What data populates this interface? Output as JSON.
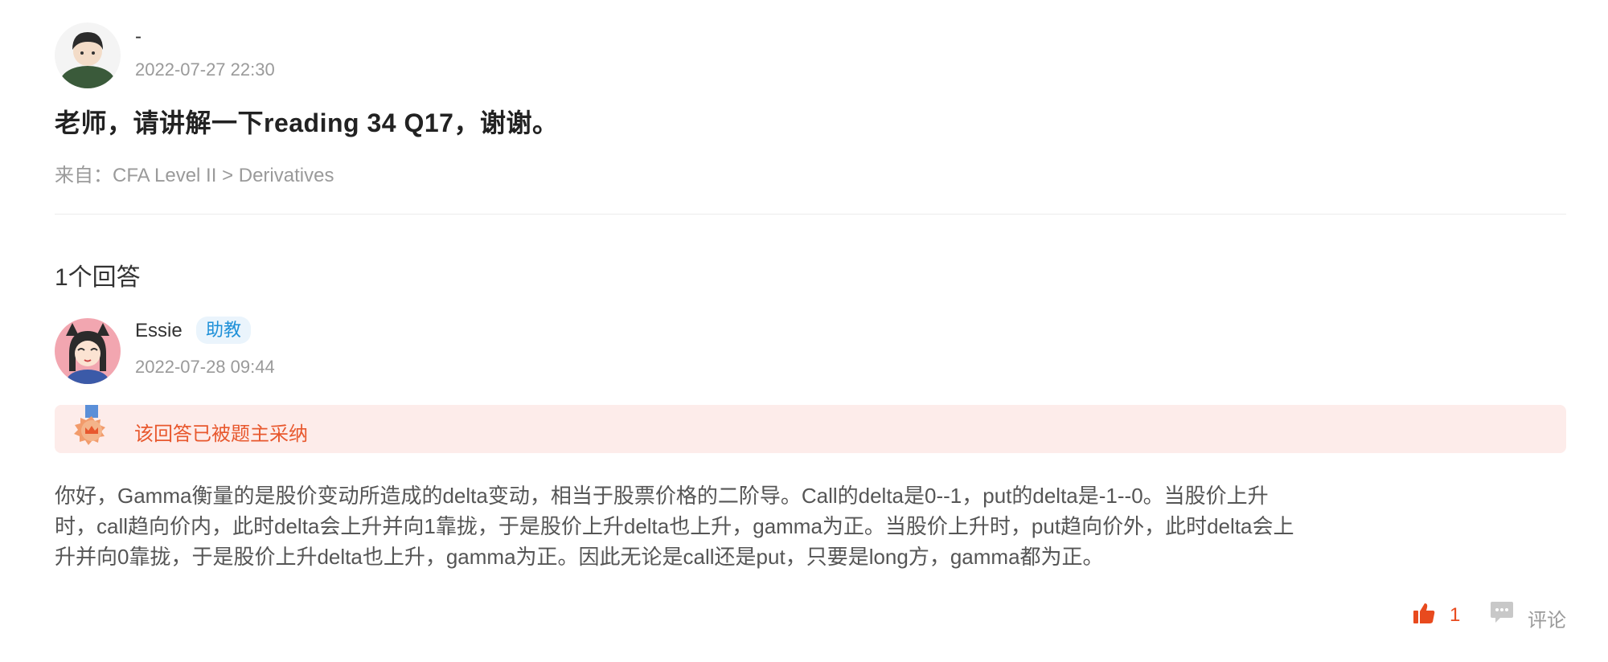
{
  "question": {
    "author_name": "-",
    "timestamp": "2022-07-27 22:30",
    "title": "老师，请讲解一下reading 34 Q17，谢谢。",
    "source": "来自：CFA Level II > Derivatives"
  },
  "answers_count": "1个回答",
  "answer": {
    "author_name": "Essie",
    "role_badge": "助教",
    "timestamp": "2022-07-28 09:44",
    "adopted_notice": "该回答已被题主采纳",
    "body_lines": [
      "你好，Gamma衡量的是股价变动所造成的delta变动，相当于股票价格的二阶导。Call的delta是0--1，put的delta是-1--0。当股价上升",
      "时，call趋向价内，此时delta会上升并向1靠拢，于是股价上升delta也上升，gamma为正。当股价上升时，put趋向价外，此时delta会上",
      "升并向0靠拢，于是股价上升delta也上升，gamma为正。因此无论是call还是put，只要是long方，gamma都为正。"
    ],
    "likes": "1",
    "comment_label": "评论"
  },
  "colors": {
    "accent": "#e8582e",
    "badge_blue": "#1e90d8",
    "adopted_bg": "#fdecea"
  },
  "icons": [
    "thumbs-up-icon",
    "comment-icon",
    "medal-icon"
  ]
}
